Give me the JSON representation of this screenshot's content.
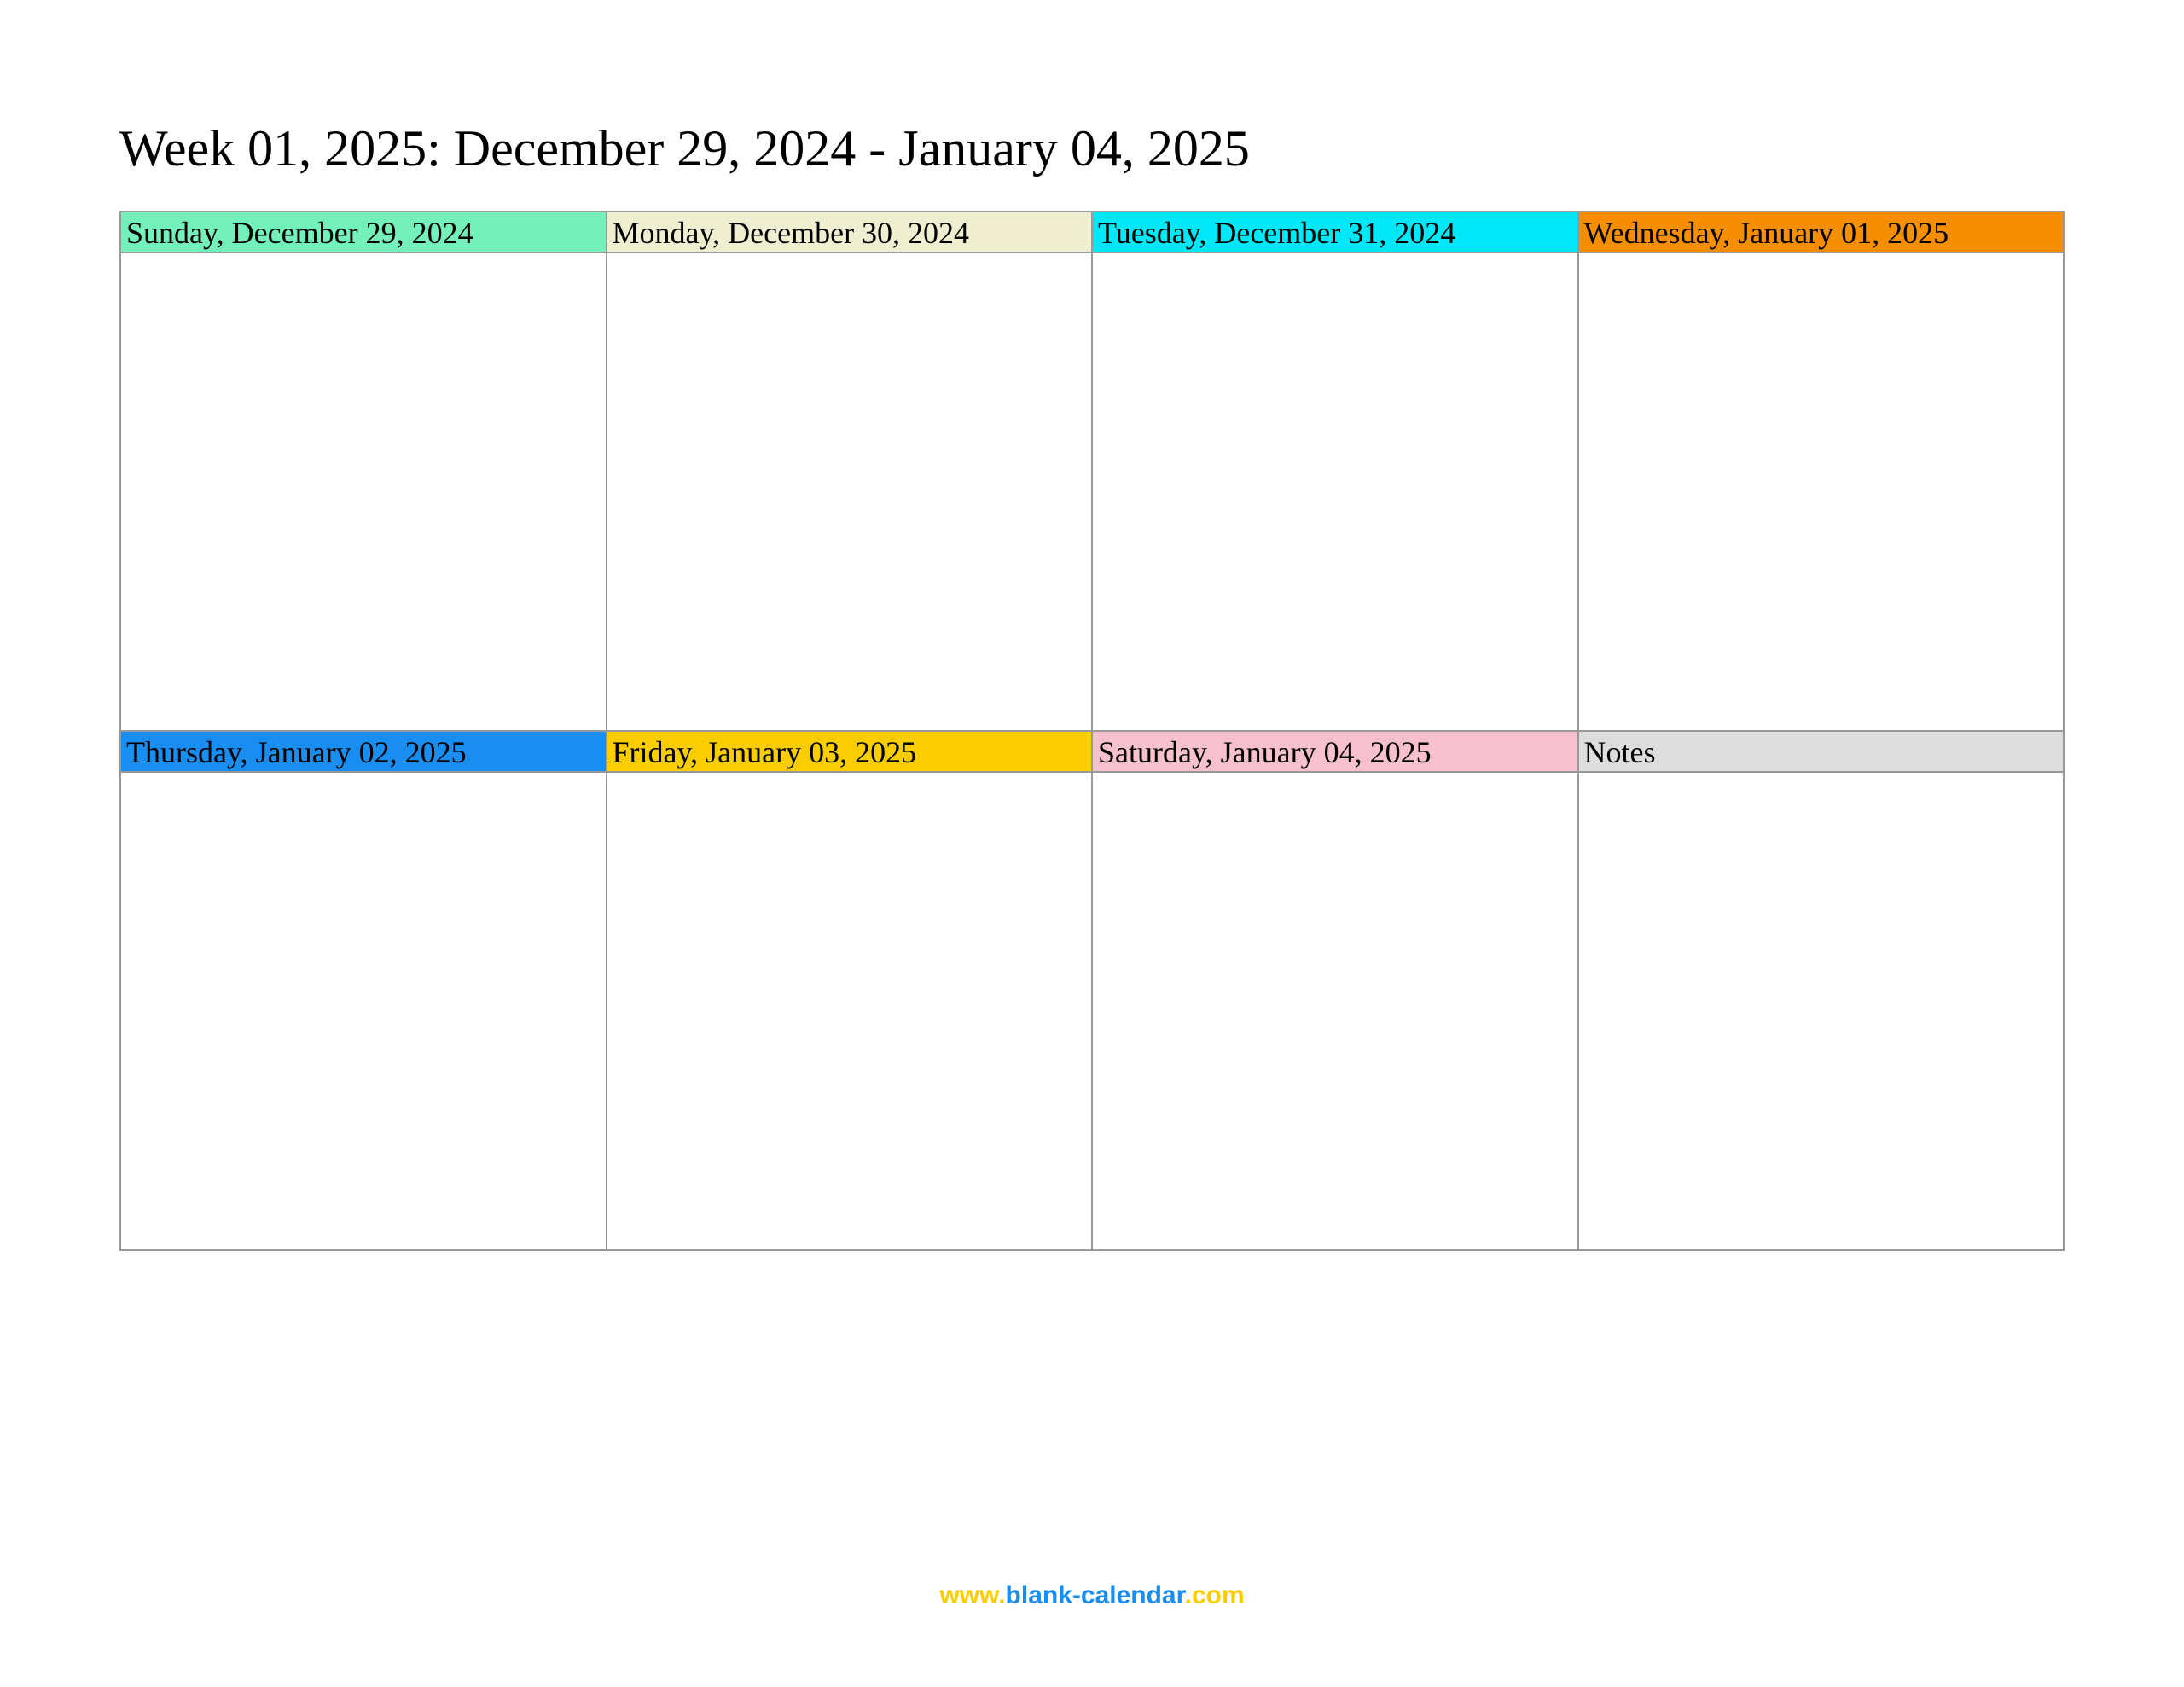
{
  "title": "Week 01, 2025: December 29, 2024 - January 04, 2025",
  "cells": {
    "row1": [
      {
        "label": "Sunday, December 29, 2024"
      },
      {
        "label": "Monday, December 30, 2024"
      },
      {
        "label": "Tuesday, December 31, 2024"
      },
      {
        "label": "Wednesday, January 01, 2025"
      }
    ],
    "row2": [
      {
        "label": "Thursday, January 02, 2025"
      },
      {
        "label": "Friday, January 03, 2025"
      },
      {
        "label": "Saturday, January 04, 2025"
      },
      {
        "label": "Notes"
      }
    ]
  },
  "footer": {
    "www": "www.",
    "domain": "blank-calendar",
    "com": ".com"
  }
}
